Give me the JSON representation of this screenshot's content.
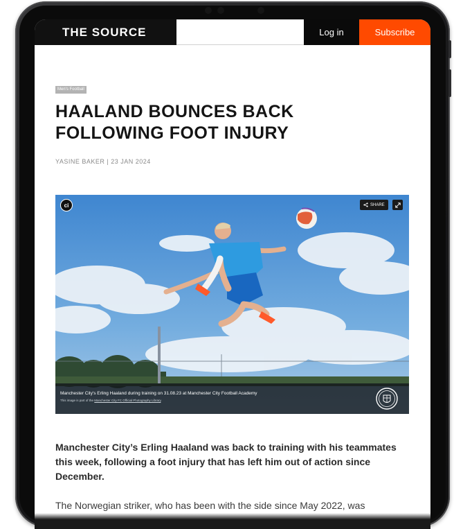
{
  "site": {
    "brand": "THE SOURCE",
    "login_label": "Log in",
    "subscribe_label": "Subscribe"
  },
  "article": {
    "category": "Men's Football",
    "headline_line1": "HAALAND BOUNCES BACK",
    "headline_line2": "FOLLOWING FOOT INJURY",
    "byline": "YASINE BAKER | 23 JAN 2024",
    "lede": "Manchester City’s Erling Haaland was back to training with his teammates this week, following a foot injury that has left him out of action since December.",
    "paragraph": "The Norwegian striker, who has been with the side since May 2022, was"
  },
  "media": {
    "badge_logo": "ci",
    "share_label": "SHARE",
    "caption": "Manchester City's Erling Haaland during training on 31.08.23 at Manchester City Football Academy",
    "credit_prefix": "This image is part of the ",
    "credit_link": "Manchester City FC Official Photography Library",
    "credit_suffix": "."
  },
  "icons": {
    "share": "share-icon",
    "expand": "expand-icon",
    "crest": "manchester-city-crest-icon"
  },
  "colors": {
    "subscribe_bg": "#ff4a00",
    "nav_bg": "#111111",
    "sky": "#4f93d6"
  }
}
